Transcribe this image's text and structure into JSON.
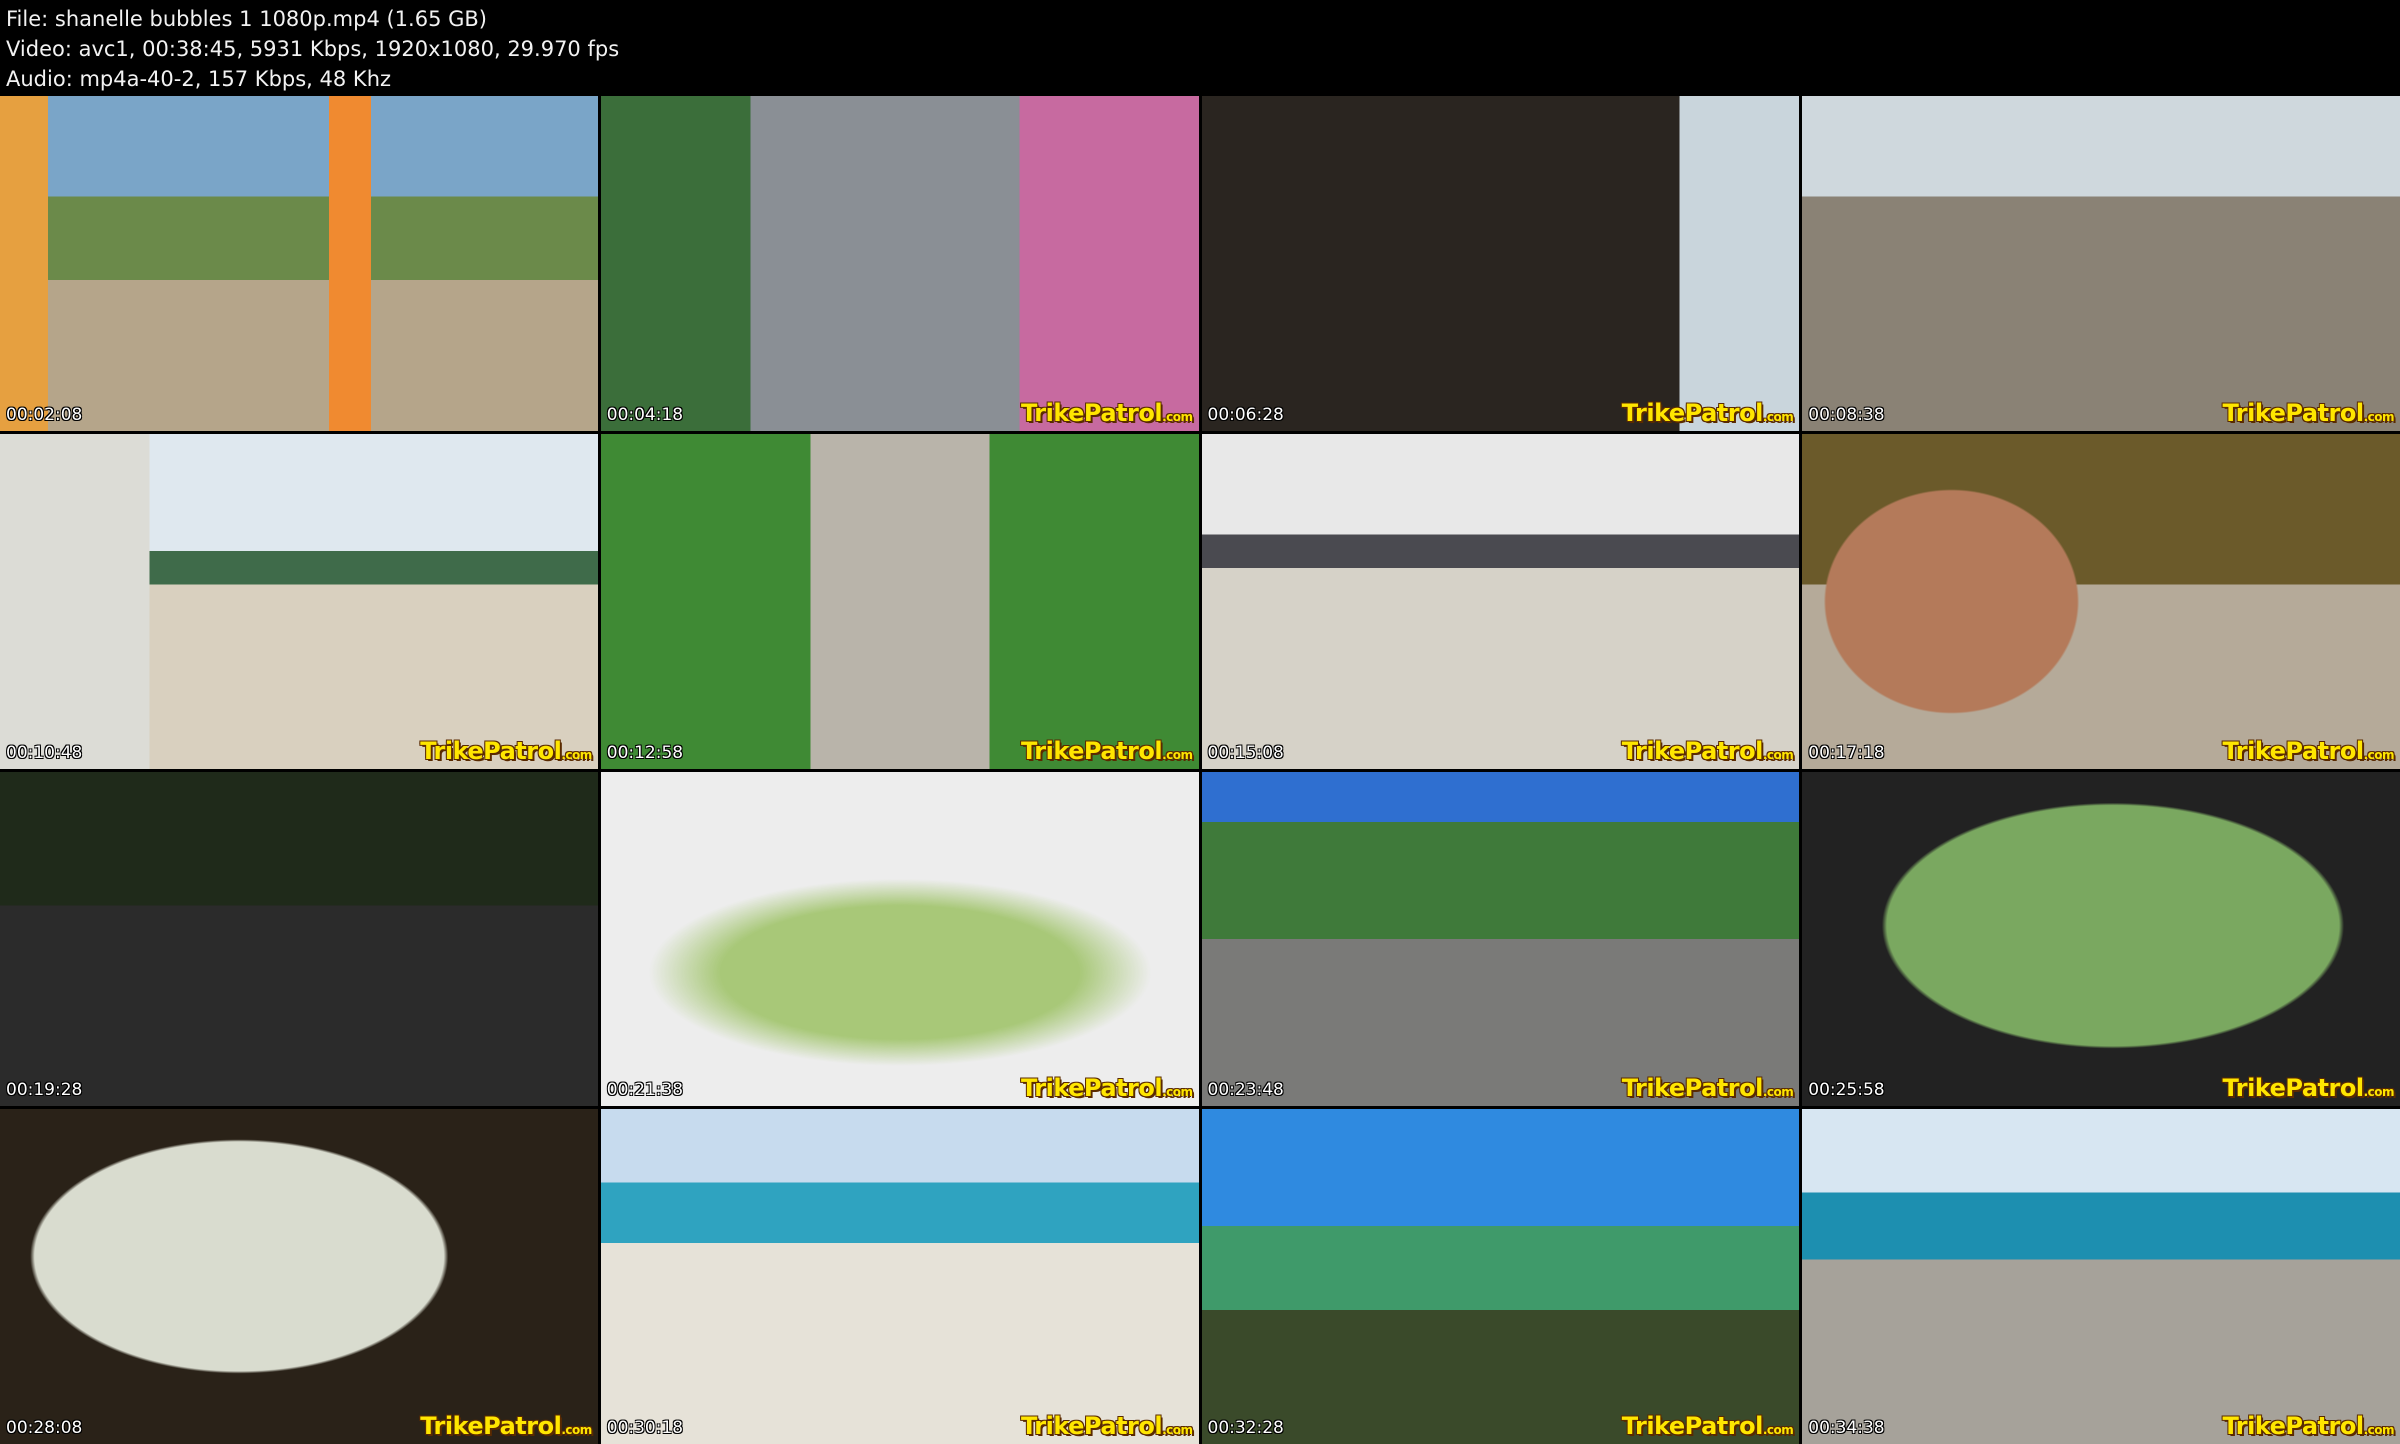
{
  "header": {
    "file_line": "File: shanelle bubbles 1 1080p.mp4 (1.65 GB)",
    "video_line": "Video: avc1, 00:38:45, 5931 Kbps, 1920x1080, 29.970 fps",
    "audio_line": "Audio: mp4a-40-2, 157 Kbps, 48 Khz"
  },
  "watermark": {
    "brand": "TrikePatrol",
    "suffix": ".com"
  },
  "thumbnails": [
    {
      "timestamp": "00:02:08"
    },
    {
      "timestamp": "00:04:18"
    },
    {
      "timestamp": "00:06:28"
    },
    {
      "timestamp": "00:08:38"
    },
    {
      "timestamp": "00:10:48"
    },
    {
      "timestamp": "00:12:58"
    },
    {
      "timestamp": "00:15:08"
    },
    {
      "timestamp": "00:17:18"
    },
    {
      "timestamp": "00:19:28"
    },
    {
      "timestamp": "00:21:38"
    },
    {
      "timestamp": "00:23:48"
    },
    {
      "timestamp": "00:25:58"
    },
    {
      "timestamp": "00:28:08"
    },
    {
      "timestamp": "00:30:18"
    },
    {
      "timestamp": "00:32:28"
    },
    {
      "timestamp": "00:34:38"
    }
  ],
  "colors": {
    "background": "#000000",
    "watermark": "#ffe600"
  }
}
